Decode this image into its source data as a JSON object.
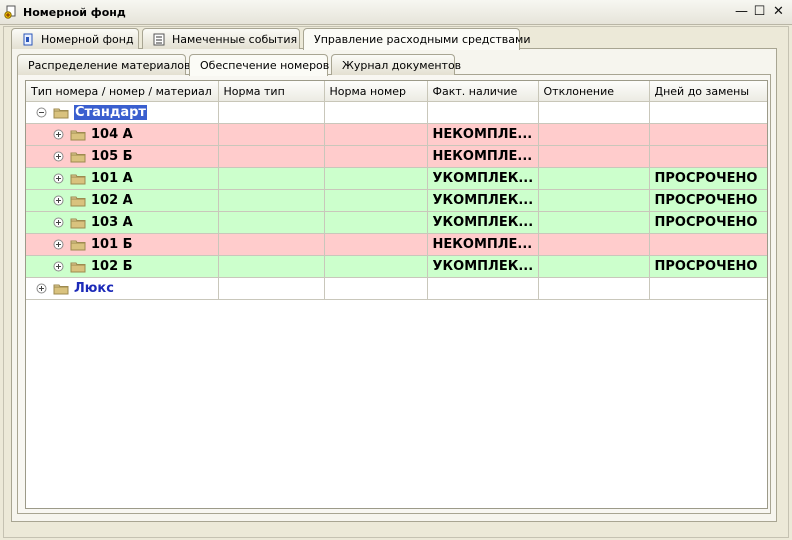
{
  "window": {
    "title": "Номерной фонд"
  },
  "tabs": [
    {
      "label": "Номерной фонд"
    },
    {
      "label": "Намеченные события"
    },
    {
      "label": "Управление расходными средствами"
    }
  ],
  "subtabs": [
    {
      "label": "Распределение материалов"
    },
    {
      "label": "Обеспечение номеров"
    },
    {
      "label": "Журнал документов"
    }
  ],
  "columns": [
    "Тип номера / номер / материал",
    "Норма тип",
    "Норма номер",
    "Факт. наличие",
    "Отклонение",
    "Дней до замены"
  ],
  "groups": [
    {
      "name": "Стандарт",
      "rows": [
        {
          "room": "104 А",
          "fact": "НЕКОМПЛЕ...",
          "days": ""
        },
        {
          "room": "105 Б",
          "fact": "НЕКОМПЛЕ...",
          "days": ""
        },
        {
          "room": "101 А",
          "fact": "УКОМПЛЕК...",
          "days": "ПРОСРОЧЕНО"
        },
        {
          "room": "102 А",
          "fact": "УКОМПЛЕК...",
          "days": "ПРОСРОЧЕНО"
        },
        {
          "room": "103 А",
          "fact": "УКОМПЛЕК...",
          "days": "ПРОСРОЧЕНО"
        },
        {
          "room": "101 Б",
          "fact": "НЕКОМПЛЕ...",
          "days": ""
        },
        {
          "room": "102 Б",
          "fact": "УКОМПЛЕК...",
          "days": "ПРОСРОЧЕНО"
        }
      ]
    },
    {
      "name": "Люкс",
      "rows": []
    }
  ],
  "colors": {
    "incomplete": "#ffcccc",
    "complete": "#ccffcc",
    "group_text": "#1c2ab8",
    "selection": "#3a5fcf"
  }
}
